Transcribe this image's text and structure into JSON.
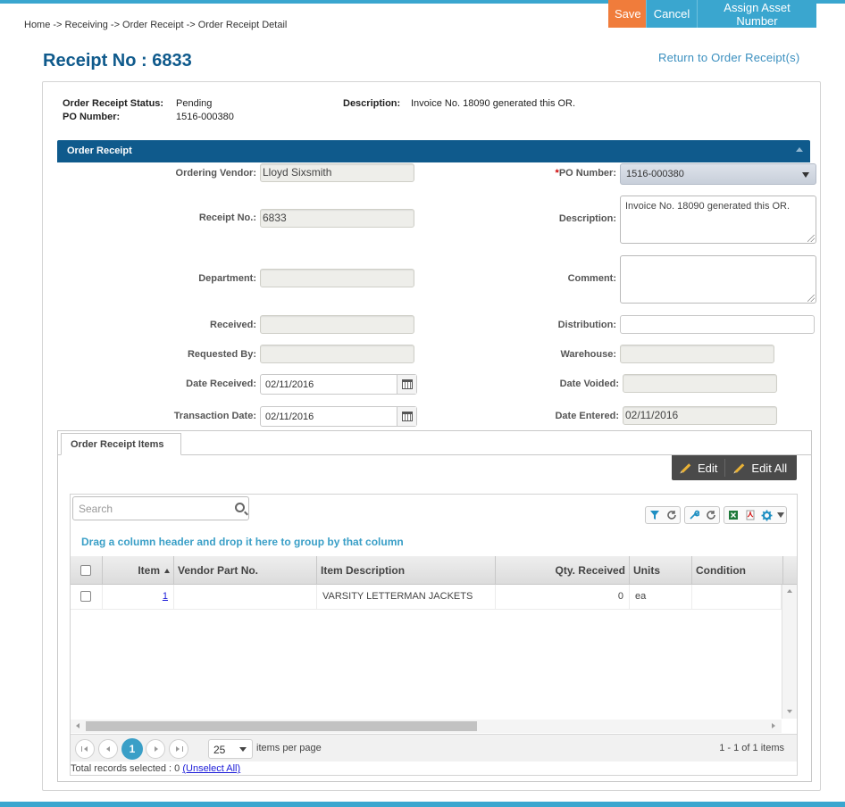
{
  "breadcrumb": "Home -> Receiving -> Order Receipt -> Order Receipt Detail",
  "toolbar": {
    "save_label": "Save",
    "cancel_label": "Cancel",
    "assign_label": "Assign Asset Number"
  },
  "page": {
    "title": "Receipt No : 6833",
    "return_link": "Return to Order Receipt(s)"
  },
  "summary": {
    "status_label": "Order Receipt Status:",
    "status_value": "Pending",
    "po_label": "PO Number:",
    "po_value": "1516-000380",
    "desc_label": "Description:",
    "desc_value": "Invoice No. 18090 generated this OR."
  },
  "section": {
    "title": "Order Receipt"
  },
  "form": {
    "ordering_vendor_label": "Ordering Vendor:",
    "ordering_vendor_value": "Lloyd Sixsmith",
    "po_number_required": "*",
    "po_number_label": "PO Number:",
    "po_number_value": "1516-000380",
    "receipt_no_label": "Receipt No.:",
    "receipt_no_value": "6833",
    "description_label": "Description:",
    "description_value": "Invoice No. 18090 generated this OR.",
    "department_label": "Department:",
    "department_value": "",
    "comment_label": "Comment:",
    "comment_value": "",
    "received_label": "Received:",
    "received_value": "",
    "distribution_label": "Distribution:",
    "distribution_value": "",
    "requested_by_label": "Requested By:",
    "requested_by_value": "",
    "warehouse_label": "Warehouse:",
    "warehouse_value": "",
    "date_received_label": "Date Received:",
    "date_received_value": "02/11/2016",
    "date_voided_label": "Date Voided:",
    "date_voided_value": "",
    "transaction_date_label": "Transaction Date:",
    "transaction_date_value": "02/11/2016",
    "date_entered_label": "Date Entered:",
    "date_entered_value": "02/11/2016"
  },
  "items_tab": {
    "label": "Order Receipt Items",
    "edit_label": "Edit",
    "edit_all_label": "Edit All"
  },
  "grid": {
    "search_placeholder": "Search",
    "group_hint": "Drag a column header and drop it here to group by that column",
    "columns": [
      "Item",
      "Vendor Part No.",
      "Item Description",
      "Qty. Received",
      "Units",
      "Condition"
    ],
    "rows": [
      {
        "item": "1",
        "vendor_part": "",
        "description": "VARSITY LETTERMAN JACKETS",
        "qty": "0",
        "units": "ea",
        "condition": ""
      }
    ],
    "tool_icons": [
      "filter-icon",
      "refresh-icon",
      "wrench-icon",
      "refresh-icon",
      "excel-icon",
      "pdf-icon",
      "gear-icon"
    ]
  },
  "pager": {
    "current_page": "1",
    "page_size": "25",
    "items_per_page": "items per page",
    "info": "1 - 1 of 1 items"
  },
  "footer": {
    "records_selected": "Total records selected : 0 ",
    "unselect_all": "(Unselect All)"
  },
  "colors": {
    "accent": "#3aa6cf",
    "save": "#f07c3b",
    "header_blue": "#0f5a8c"
  }
}
